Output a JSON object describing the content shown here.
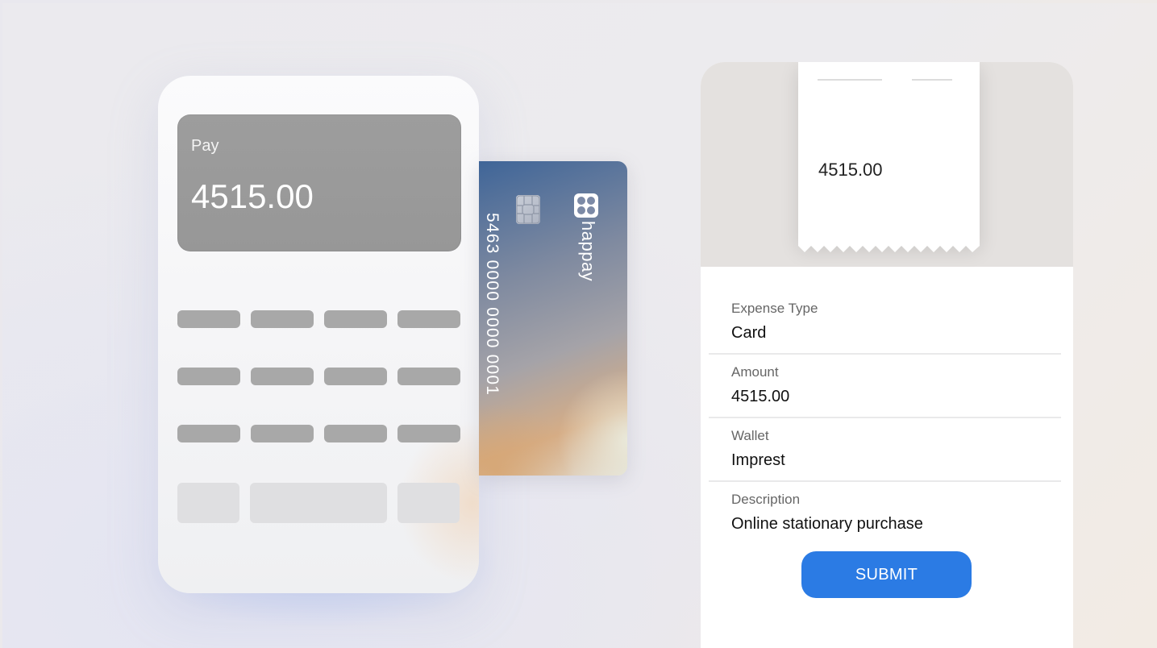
{
  "terminal": {
    "pay_label": "Pay",
    "pay_amount": "4515.00"
  },
  "card": {
    "number": "5463 0000 0000 0001",
    "brand": "happay",
    "chip_icon": "card-chip-icon",
    "logo_icon": "happay-logo-icon"
  },
  "receipt": {
    "amount": "4515.00"
  },
  "form": {
    "fields": [
      {
        "label": "Expense Type",
        "value": "Card"
      },
      {
        "label": "Amount",
        "value": "4515.00"
      },
      {
        "label": "Wallet",
        "value": "Imprest"
      },
      {
        "label": "Description",
        "value": "Online stationary purchase"
      }
    ],
    "submit_label": "SUBMIT"
  },
  "colors": {
    "accent": "#2b7be4",
    "screen": "#9d9d9d"
  }
}
